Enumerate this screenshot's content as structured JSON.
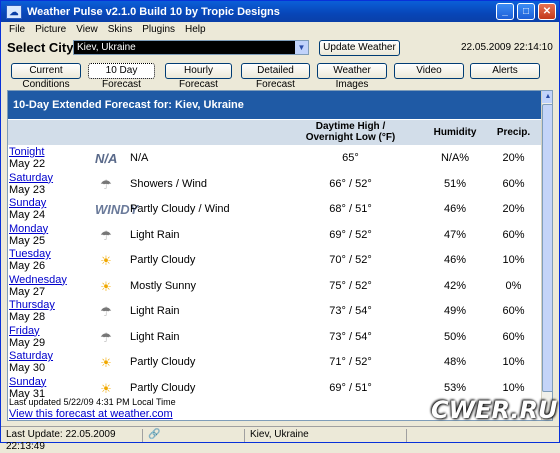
{
  "window": {
    "title": "Weather Pulse v2.1.0 Build 10 by Tropic Designs"
  },
  "menu": [
    "File",
    "Picture",
    "View",
    "Skins",
    "Plugins",
    "Help"
  ],
  "city": {
    "label": "Select City",
    "value": "Kiev, Ukraine",
    "update_button": "Update Weather",
    "datetime": "22.05.2009 22:14:10"
  },
  "tabs": [
    "Current Conditions",
    "10 Day Forecast",
    "Hourly Forecast",
    "Detailed Forecast",
    "Weather Images",
    "Video",
    "Alerts"
  ],
  "active_tab": "10 Day Forecast",
  "forecast": {
    "heading": "10-Day Extended Forecast for: Kiev, Ukraine",
    "columns": {
      "temp": "Daytime High /",
      "temp2": "Overnight Low (°F)",
      "humidity": "Humidity",
      "precip": "Precip."
    },
    "rows": [
      {
        "day": "Tonight",
        "date": "May 22",
        "icon": "na-icon",
        "condition": "N/A",
        "temp": "65°",
        "humidity": "N/A%",
        "precip": "20%"
      },
      {
        "day": "Saturday",
        "date": "May 23",
        "icon": "showers-icon",
        "condition": "Showers / Wind",
        "temp": "66° / 52°",
        "humidity": "51%",
        "precip": "60%"
      },
      {
        "day": "Sunday",
        "date": "May 24",
        "icon": "windy-icon",
        "condition": "Partly Cloudy / Wind",
        "temp": "68° / 51°",
        "humidity": "46%",
        "precip": "20%"
      },
      {
        "day": "Monday",
        "date": "May 25",
        "icon": "rain-icon",
        "condition": "Light Rain",
        "temp": "69° / 52°",
        "humidity": "47%",
        "precip": "60%"
      },
      {
        "day": "Tuesday",
        "date": "May 26",
        "icon": "partly-cloudy-icon",
        "condition": "Partly Cloudy",
        "temp": "70° / 52°",
        "humidity": "46%",
        "precip": "10%"
      },
      {
        "day": "Wednesday",
        "date": "May 27",
        "icon": "mostly-sunny-icon",
        "condition": "Mostly Sunny",
        "temp": "75° / 52°",
        "humidity": "42%",
        "precip": "0%"
      },
      {
        "day": "Thursday",
        "date": "May 28",
        "icon": "rain-icon",
        "condition": "Light Rain",
        "temp": "73° / 54°",
        "humidity": "49%",
        "precip": "60%"
      },
      {
        "day": "Friday",
        "date": "May 29",
        "icon": "rain-icon",
        "condition": "Light Rain",
        "temp": "73° / 54°",
        "humidity": "50%",
        "precip": "60%"
      },
      {
        "day": "Saturday",
        "date": "May 30",
        "icon": "partly-cloudy-icon",
        "condition": "Partly Cloudy",
        "temp": "71° / 52°",
        "humidity": "48%",
        "precip": "10%"
      },
      {
        "day": "Sunday",
        "date": "May 31",
        "icon": "partly-cloudy-icon",
        "condition": "Partly Cloudy",
        "temp": "69° / 51°",
        "humidity": "53%",
        "precip": "10%"
      }
    ],
    "last_updated": "Last updated 5/22/09 4:31 PM Local Time",
    "link": "View this forecast at weather.com"
  },
  "status": {
    "last_update": "Last Update: 22.05.2009 22:13:49",
    "city": "Kiev, Ukraine"
  },
  "watermark": "CWER.RU"
}
